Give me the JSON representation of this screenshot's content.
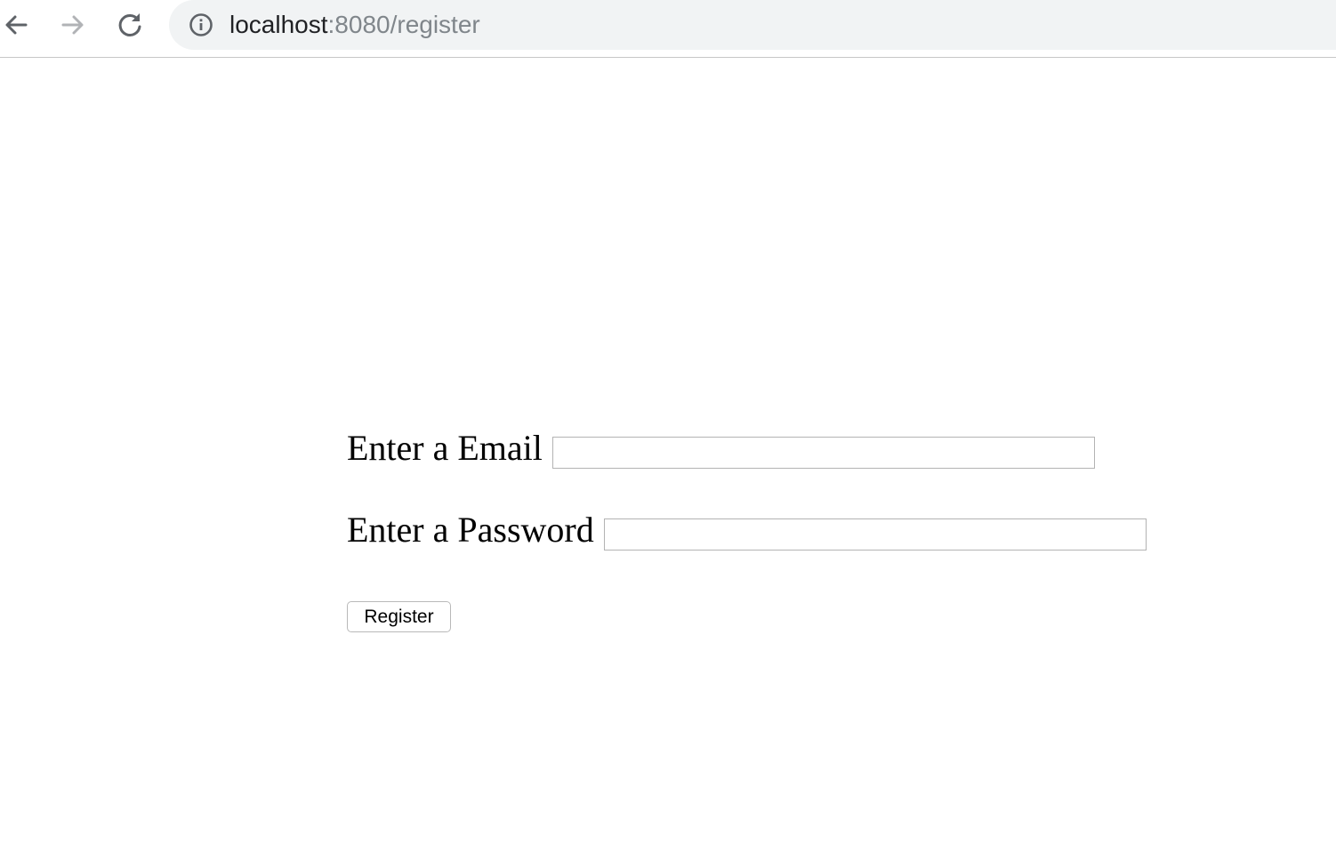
{
  "browser": {
    "url_host": "localhost",
    "url_rest": ":8080/register",
    "icons": {
      "back": "arrow-left-icon",
      "forward": "arrow-right-icon",
      "reload": "reload-icon",
      "site_info": "info-circle-icon"
    }
  },
  "form": {
    "email_label": "Enter a Email",
    "email_value": "",
    "password_label": "Enter a Password",
    "password_value": "",
    "submit_label": "Register"
  }
}
